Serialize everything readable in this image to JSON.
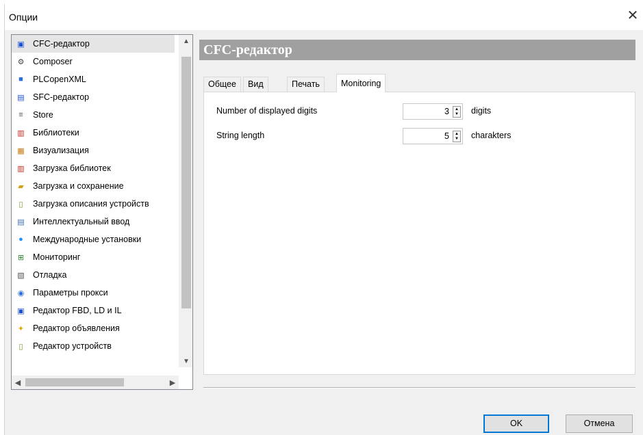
{
  "window": {
    "title": "Опции",
    "close_glyph": "✕"
  },
  "nav": {
    "items": [
      {
        "label": "CFC-редактор",
        "icon": "cfc-editor-icon",
        "glyph": "▣",
        "color": "#1a4fd6",
        "selected": true
      },
      {
        "label": "Composer",
        "icon": "composer-icon",
        "glyph": "⚙",
        "color": "#444444"
      },
      {
        "label": "PLCopenXML",
        "icon": "plcopenxml-icon",
        "glyph": "■",
        "color": "#2a6fe0"
      },
      {
        "label": "SFC-редактор",
        "icon": "sfc-editor-icon",
        "glyph": "▤",
        "color": "#1a4fd6"
      },
      {
        "label": "Store",
        "icon": "store-icon",
        "glyph": "≡",
        "color": "#555555"
      },
      {
        "label": "Библиотеки",
        "icon": "libraries-icon",
        "glyph": "▥",
        "color": "#c0261b"
      },
      {
        "label": "Визуализация",
        "icon": "visualization-icon",
        "glyph": "▦",
        "color": "#c87a12"
      },
      {
        "label": "Загрузка библиотек",
        "icon": "library-load-icon",
        "glyph": "▥",
        "color": "#c0261b"
      },
      {
        "label": "Загрузка и сохранение",
        "icon": "load-save-folder-icon",
        "glyph": "▰",
        "color": "#d4a017"
      },
      {
        "label": "Загрузка описания устройств",
        "icon": "device-description-icon",
        "glyph": "▯",
        "color": "#6b8e23"
      },
      {
        "label": "Интеллектуальный ввод",
        "icon": "smart-input-icon",
        "glyph": "▤",
        "color": "#3b6fb0"
      },
      {
        "label": "Международные установки",
        "icon": "globe-icon",
        "glyph": "●",
        "color": "#1e90ff"
      },
      {
        "label": "Мониторинг",
        "icon": "monitoring-icon",
        "glyph": "⊞",
        "color": "#2e7d32"
      },
      {
        "label": "Отладка",
        "icon": "debug-icon",
        "glyph": "▧",
        "color": "#555555"
      },
      {
        "label": "Параметры прокси",
        "icon": "proxy-icon",
        "glyph": "◉",
        "color": "#2a6fe0"
      },
      {
        "label": "Редактор FBD, LD и IL",
        "icon": "fbd-editor-icon",
        "glyph": "▣",
        "color": "#1a4fd6"
      },
      {
        "label": "Редактор объявления",
        "icon": "declaration-editor-icon",
        "glyph": "✦",
        "color": "#e0a800"
      },
      {
        "label": "Редактор устройств",
        "icon": "device-editor-icon",
        "glyph": "▯",
        "color": "#6b8e23"
      }
    ],
    "scroll_up": "▲",
    "scroll_down": "▼",
    "scroll_left": "◀",
    "scroll_right": "▶"
  },
  "section": {
    "title": "CFC-редактор"
  },
  "tabs": [
    {
      "label": "Общее",
      "active": false
    },
    {
      "label": "Вид",
      "active": false
    },
    {
      "label": "Печать",
      "active": false
    },
    {
      "label": "Monitoring",
      "active": true
    }
  ],
  "monitoring": {
    "digits": {
      "label": "Number of displayed digits",
      "value": "3",
      "unit": "digits"
    },
    "string_length": {
      "label": "String length",
      "value": "5",
      "unit": "charakters"
    }
  },
  "spin_glyphs": {
    "up": "▲",
    "down": "▼"
  },
  "buttons": {
    "ok": "OK",
    "cancel": "Отмена"
  }
}
